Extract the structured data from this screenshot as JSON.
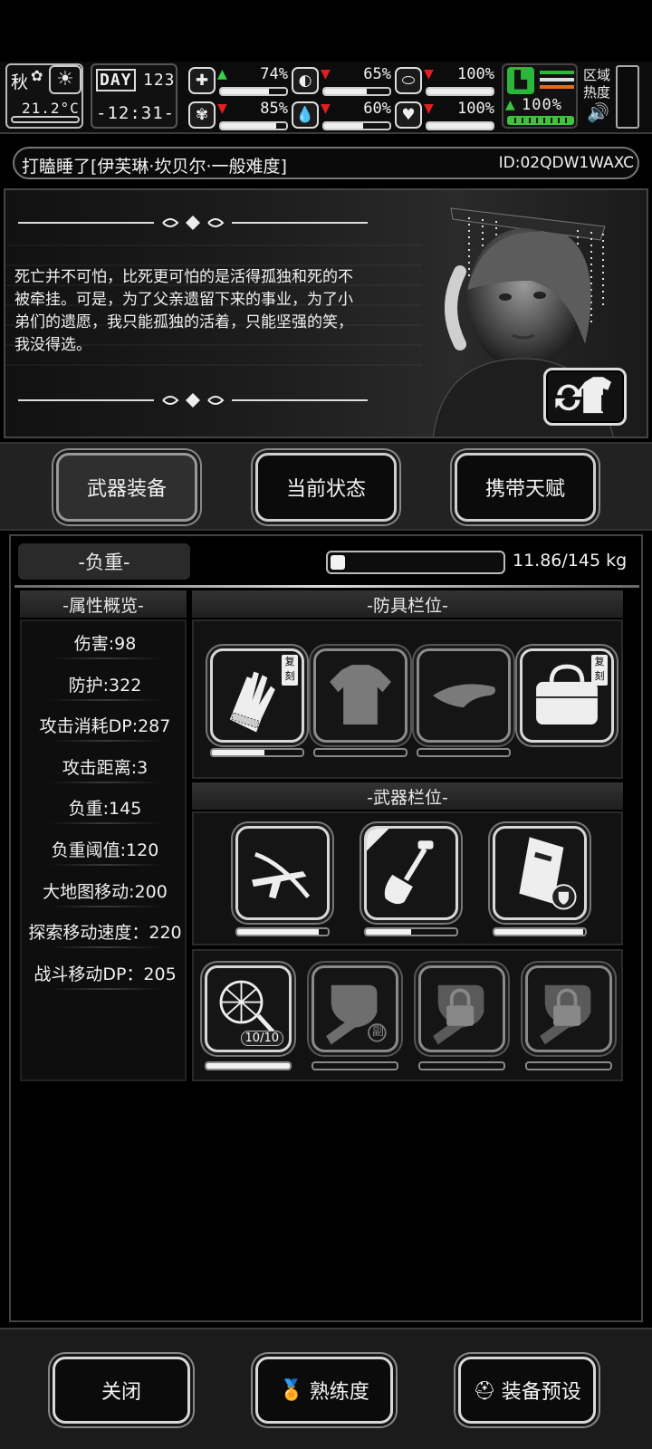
{
  "hud": {
    "season": "秋",
    "temperature": "21.2°C",
    "day_label": "DAY",
    "day": "123",
    "time": "-12:31-",
    "stats": [
      {
        "icon": "medkit-icon",
        "arrow": "up",
        "value": "74%",
        "fill": 0.74
      },
      {
        "icon": "stomach-icon",
        "arrow": "down",
        "value": "65%",
        "fill": 0.65
      },
      {
        "icon": "pill-icon",
        "arrow": "down",
        "value": "100%",
        "fill": 1.0
      },
      {
        "icon": "brain-icon",
        "arrow": "down",
        "value": "85%",
        "fill": 0.85
      },
      {
        "icon": "water-drop-icon",
        "arrow": "down",
        "value": "60%",
        "fill": 0.6
      },
      {
        "icon": "heart-icon",
        "arrow": "down",
        "value": "100%",
        "fill": 1.0
      }
    ],
    "stamina": {
      "arrow": "up",
      "value": "100%",
      "fill": 1.0
    },
    "zone_heat_label": "区域热度",
    "colors": {
      "up": "#38d24a",
      "down": "#e02020",
      "stamina": "#3cc43c"
    }
  },
  "title": {
    "text": "打瞌睡了[伊芙琳·坎贝尔·一般难度]",
    "id": "ID:02QDW1WAXC"
  },
  "story": {
    "text": "死亡并不可怕，比死更可怕的是活得孤独和死的不被牵挂。可是，为了父亲遗留下来的事业，为了小弟们的遗愿，我只能孤独的活着，只能坚强的笑，我没得选。"
  },
  "tabs": [
    {
      "label": "武器装备",
      "active": true
    },
    {
      "label": "当前状态",
      "active": false
    },
    {
      "label": "携带天赋",
      "active": false
    }
  ],
  "load": {
    "label": "-负重-",
    "text": "11.86/145 kg",
    "fill": 0.082
  },
  "attributes": {
    "header": "-属性概览-",
    "items": [
      "伤害:98",
      "防护:322",
      "攻击消耗DP:287",
      "攻击距离:3",
      "负重:145",
      "负重阈值:120",
      "大地图移动:200",
      "探索移动速度：220",
      "战斗移动DP：205"
    ]
  },
  "armor": {
    "header": "-防具栏位-",
    "slots": [
      {
        "name": "gloves",
        "badge": "复刻",
        "fill": 0.58,
        "empty": false
      },
      {
        "name": "shirt",
        "badge": "",
        "fill": 0,
        "empty": true
      },
      {
        "name": "cap",
        "badge": "",
        "fill": 0,
        "empty": true
      },
      {
        "name": "bag",
        "badge": "复刻",
        "fill": 0,
        "empty": false
      }
    ]
  },
  "weapons": {
    "header": "-武器栏位-",
    "slots": [
      {
        "name": "crossbow",
        "fill": 0.9
      },
      {
        "name": "shovel",
        "fill": 0.5
      },
      {
        "name": "riot-shield",
        "fill": 0.98
      }
    ]
  },
  "extra_slots": [
    {
      "name": "net",
      "count": "10/10",
      "fill": 1.0,
      "locked": false,
      "sub": ""
    },
    {
      "name": "fist-secondary",
      "count": "",
      "fill": 0,
      "locked": false,
      "sub": "副"
    },
    {
      "name": "fist-locked-1",
      "count": "",
      "fill": 0,
      "locked": true,
      "sub": ""
    },
    {
      "name": "fist-locked-2",
      "count": "",
      "fill": 0,
      "locked": true,
      "sub": ""
    }
  ],
  "bottom": {
    "close": "关闭",
    "proficiency": "熟练度",
    "preset": "装备预设"
  }
}
